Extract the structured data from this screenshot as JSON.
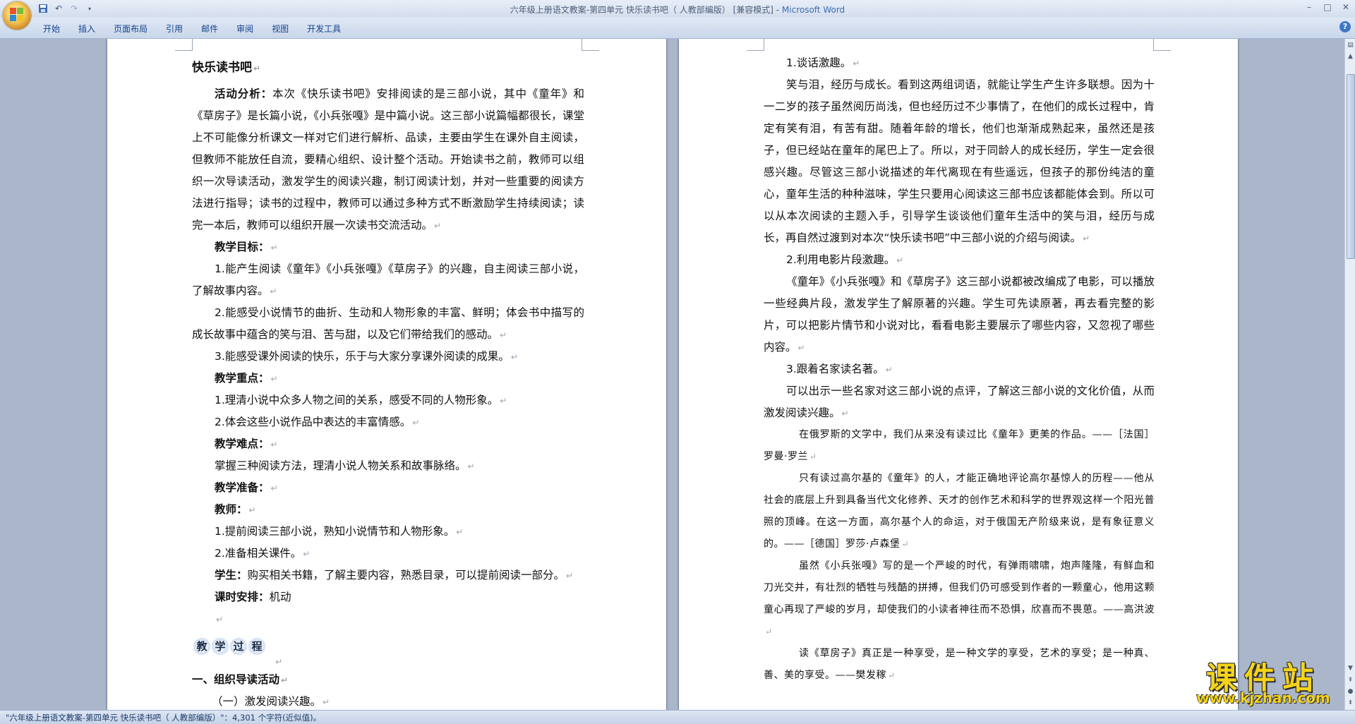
{
  "window": {
    "title_doc": "六年级上册语文教案-第四单元 快乐读书吧（ 人教部编版） [兼容模式] - ",
    "title_app": "Microsoft Word"
  },
  "quick_access": {
    "icons": [
      "save-icon",
      "undo-icon",
      "redo-icon",
      "customize-icon"
    ]
  },
  "window_controls": {
    "minimize": "–",
    "maximize": "□",
    "close": "✕"
  },
  "ribbon": {
    "tabs": [
      "开始",
      "插入",
      "页面布局",
      "引用",
      "邮件",
      "审阅",
      "视图",
      "开发工具"
    ],
    "help": "?"
  },
  "left_page": {
    "title": "快乐读书吧",
    "analysis_label": "活动分析：",
    "analysis_text": "本次《快乐读书吧》安排阅读的是三部小说，其中《童年》和《草房子》是长篇小说，《小兵张嘎》是中篇小说。这三部小说篇幅都很长，课堂上不可能像分析课文一样对它们进行解析、品读，主要由学生在课外自主阅读，但教师不能放任自流，要精心组织、设计整个活动。开始读书之前，教师可以组织一次导读活动，激发学生的阅读兴趣，制订阅读计划，并对一些重要的阅读方法进行指导；读书的过程中，教师可以通过多种方式不断激励学生持续阅读；读完一本后，教师可以组织开展一次读书交流活动。",
    "goals_label": "教学目标：",
    "goal1": "1.能产生阅读《童年》《小兵张嘎》《草房子》的兴趣，自主阅读三部小说，了解故事内容。",
    "goal2": "2.能感受小说情节的曲折、生动和人物形象的丰富、鲜明；体会书中描写的成长故事中蕴含的笑与泪、苦与甜，以及它们带给我们的感动。",
    "goal3": "3.能感受课外阅读的快乐，乐于与大家分享课外阅读的成果。",
    "key_label": "教学重点：",
    "key1": "1.理清小说中众多人物之间的关系，感受不同的人物形象。",
    "key2": "2.体会这些小说作品中表达的丰富情感。",
    "diff_label": "教学难点：",
    "diff1": "掌握三种阅读方法，理清小说人物关系和故事脉络。",
    "prep_label": "教学准备：",
    "teacher_label": "教师：",
    "teacher1": "1.提前阅读三部小说，熟知小说情节和人物形象。",
    "teacher2": "2.准备相关课件。",
    "student_label": "学生：",
    "student_text": "购买相关书籍，了解主要内容，熟悉目录，可以提前阅读一部分。",
    "time_label": "课时安排：",
    "time_text": "机动",
    "process_badge": [
      "教",
      "学",
      "过",
      "程"
    ],
    "section1": "一、组织导读活动",
    "subsection1": "（一）激发阅读兴趣。"
  },
  "right_page": {
    "p1": "1.谈话激趣。",
    "p2": "笑与泪，经历与成长。看到这两组词语，就能让学生产生许多联想。因为十一二岁的孩子虽然阅历尚浅，但也经历过不少事情了，在他们的成长过程中，肯定有笑有泪，有苦有甜。随着年龄的增长，他们也渐渐成熟起来，虽然还是孩子，但已经站在童年的尾巴上了。所以，对于同龄人的成长经历，学生一定会很感兴趣。尽管这三部小说描述的年代离现在有些遥远，但孩子的那份纯洁的童心，童年生活的种种滋味，学生只要用心阅读这三部书应该都能体会到。所以可以从本次阅读的主题入手，引导学生谈谈他们童年生活中的笑与泪，经历与成长，再自然过渡到对本次“快乐读书吧”中三部小说的介绍与阅读。",
    "p3": "2.利用电影片段激趣。",
    "p4": "《童年》《小兵张嘎》和《草房子》这三部小说都被改编成了电影，可以播放一些经典片段，激发学生了解原著的兴趣。学生可先读原著，再去看完整的影片，可以把影片情节和小说对比，看看电影主要展示了哪些内容，又忽视了哪些内容。",
    "p5": "3.跟着名家读名著。",
    "p6": "可以出示一些名家对这三部小说的点评，了解这三部小说的文化价值，从而激发阅读兴趣。",
    "q1": "在俄罗斯的文学中，我们从来没有读过比《童年》更美的作品。——［法国］罗曼·罗兰",
    "q2": "只有读过高尔基的《童年》的人，才能正确地评论高尔基惊人的历程——他从社会的底层上升到具备当代文化修养、天才的创作艺术和科学的世界观这样一个阳光普照的顶峰。在这一方面，高尔基个人的命运，对于俄国无产阶级来说，是有象征意义的。——［德国］罗莎·卢森堡",
    "q3": "虽然《小兵张嘎》写的是一个严峻的时代，有弹雨啸啸，炮声隆隆，有鲜血和刀光交并，有壮烈的牺牲与残酷的拼搏，但我们仍可感受到作者的一颗童心，他用这颗童心再现了严峻的岁月，却使我们的小读者神往而不恐惧，欣喜而不畏葸。——高洪波",
    "q4": "读《草房子》真正是一种享受，是一种文学的享受，艺术的享受；是一种真、善、美的享受。——樊发稼"
  },
  "status": {
    "text": "\"六年级上册语文教案-第四单元 快乐读书吧（ 人教部编版）\"：4,301 个字符(近似值)。"
  },
  "watermark": {
    "title": "课件站",
    "url": "www.kjzhan.com"
  },
  "colors": {
    "ribbon_text": "#15428b",
    "workspace": "#aab6ca",
    "watermark": "#f5d31a"
  }
}
